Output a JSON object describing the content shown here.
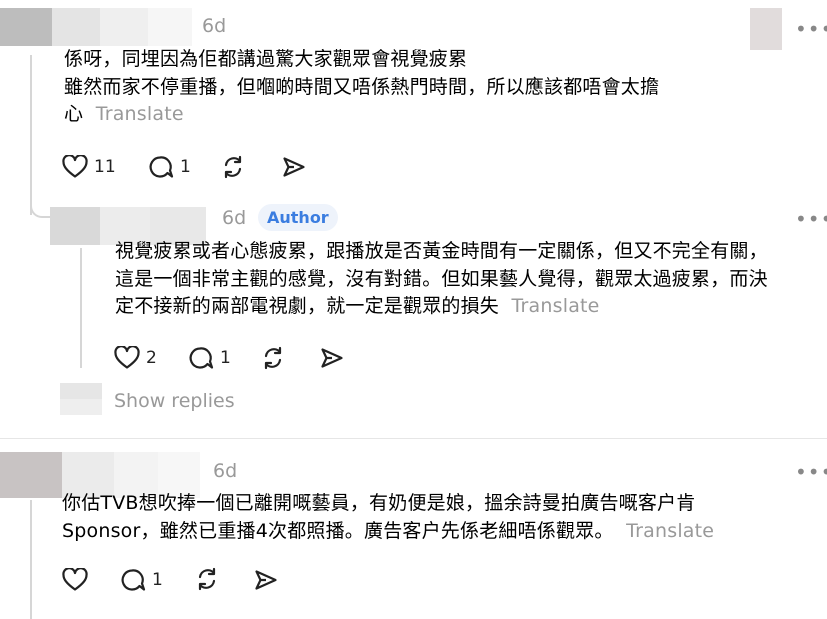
{
  "comments": [
    {
      "time": "6d",
      "lines": [
        "係呀，同埋￼因為佢都講過驚￼￼大家觀眾￼會視覺￼￼疲累",
        "雖然￼而家￼不停重播￼，但嗰啲時間又唔係熱門時間，所以應該都唔會太擔",
        "心"
      ],
      "translate": "Translate",
      "likes": "11",
      "replies": "1"
    },
    {
      "time": "6d",
      "author_badge": "Author",
      "lines": [
        "視覺疲累或者心態疲累，跟播放是否黃金時間有一定關係，但又不完全有關，",
        "這是一個非常主觀的感覺，沒有對錯。但如果藝人覺得，觀眾太過疲累，而決",
        "定不接新的兩部電視劇，就一定是觀眾的損失"
      ],
      "translate": "Translate",
      "likes": "2",
      "replies": "1"
    },
    {
      "time": "6d",
      "lines": [
        "你估TVB想吹捧一個已離開嘅藝員，有奶便是娘，搵余詩曼拍廣告嘅客户肯",
        "Sponsor，雖然已重播4次都照播。廣告客户先係老細唔係觀眾。"
      ],
      "translate": "Translate",
      "likes": "",
      "replies": "1"
    }
  ],
  "show_replies": "Show replies",
  "more_icon": "•••",
  "icons": [
    "heart-icon",
    "comment-icon",
    "repost-icon",
    "share-icon",
    "more-icon"
  ]
}
